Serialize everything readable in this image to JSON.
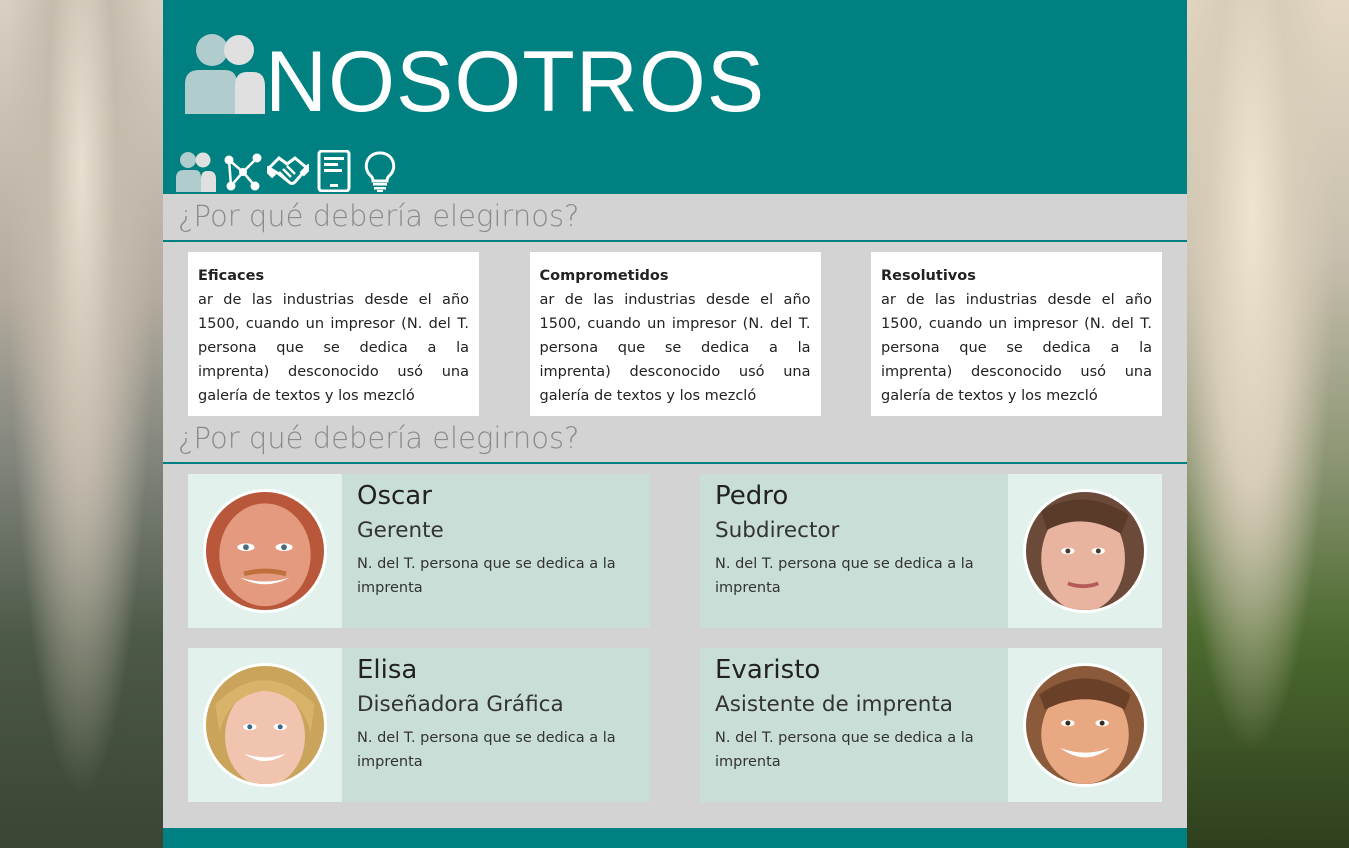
{
  "header": {
    "title": "NOSOTROS",
    "logo_icon": "users-icon",
    "nav_icons": [
      "users-icon",
      "network-icon",
      "handshake-icon",
      "tablet-icon",
      "lightbulb-icon"
    ]
  },
  "section1": {
    "title": "¿Por qué debería elegirnos?",
    "cards": [
      {
        "title": "Eficaces",
        "text": "ar de las industrias desde el año 1500, cuando un impresor (N. del T. persona que se dedica a la imprenta) desconocido usó una galería de textos y los mezcló"
      },
      {
        "title": "Comprometidos",
        "text": "ar de las industrias desde el año 1500, cuando un impresor (N. del T. persona que se dedica a la imprenta) desconocido usó una galería de textos y los mezcló"
      },
      {
        "title": "Resolutivos",
        "text": "ar de las industrias desde el año 1500, cuando un impresor (N. del T. persona que se dedica a la imprenta) desconocido usó una galería de textos y los mezcló"
      }
    ]
  },
  "section2": {
    "title": "¿Por qué debería elegirnos?",
    "members": [
      {
        "name": "Oscar",
        "role": "Gerente",
        "desc": "N. del T. persona que se dedica a la imprenta"
      },
      {
        "name": "Pedro",
        "role": "Subdirector",
        "desc": "N. del T. persona que se dedica a la imprenta"
      },
      {
        "name": "Elisa",
        "role": "Diseñadora Gráfica",
        "desc": "N. del T. persona que se dedica a la imprenta"
      },
      {
        "name": "Evaristo",
        "role": "Asistente de imprenta",
        "desc": "N. del T. persona que se dedica a la imprenta"
      }
    ]
  },
  "colors": {
    "primary": "#008080",
    "panel": "#d3d3d3",
    "member_bg": "#c8ded7",
    "member_pic_bg": "#e3f1ec",
    "heading_gray": "#8a8a8a"
  }
}
